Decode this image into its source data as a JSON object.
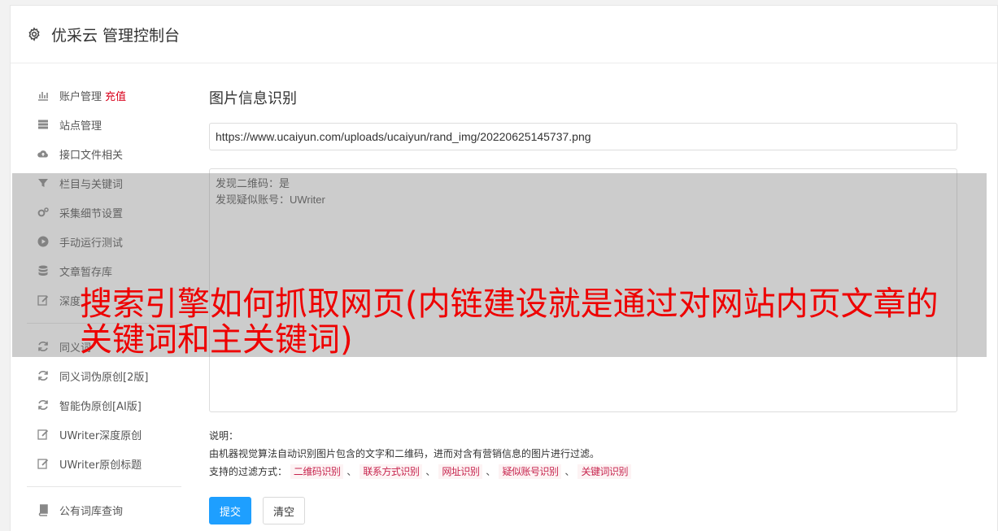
{
  "header": {
    "title": "优采云 管理控制台",
    "icon": "gear-icon"
  },
  "sidebar": {
    "items": [
      {
        "label": "账户管理",
        "extra": "充值",
        "icon": "bar-chart-icon"
      },
      {
        "label": "站点管理",
        "icon": "server-icon"
      },
      {
        "label": "接口文件相关",
        "icon": "cloud-upload-icon"
      },
      {
        "label": "栏目与关键词",
        "icon": "filter-icon"
      },
      {
        "label": "采集细节设置",
        "icon": "gears-icon"
      },
      {
        "label": "手动运行测试",
        "icon": "play-circle-icon"
      },
      {
        "label": "文章暂存库",
        "icon": "database-icon"
      },
      {
        "label": "深度",
        "icon": "edit-icon"
      }
    ],
    "items2": [
      {
        "label": "同义词",
        "icon": "refresh-icon"
      },
      {
        "label": "同义词伪原创[2版]",
        "icon": "refresh-icon"
      },
      {
        "label": "智能伪原创[AI版]",
        "icon": "refresh-icon"
      },
      {
        "label": "UWriter深度原创",
        "icon": "edit-icon"
      },
      {
        "label": "UWriter原创标题",
        "icon": "edit-icon"
      }
    ],
    "items3": [
      {
        "label": "公有词库查询",
        "icon": "book-icon"
      }
    ]
  },
  "main": {
    "title": "图片信息识别",
    "url_value": "https://www.ucaiyun.com/uploads/ucaiyun/rand_img/20220625145737.png",
    "result_value": "发现二维码：是\n发现疑似账号：UWriter",
    "notes_label": "说明：",
    "notes_desc": "由机器视觉算法自动识别图片包含的文字和二维码，进而对含有营销信息的图片进行过滤。",
    "filters_label": "支持的过滤方式：",
    "filters": [
      "二维码识别",
      "联系方式识别",
      "网址识别",
      "疑似账号识别",
      "关键词识别"
    ],
    "submit_label": "提交",
    "clear_label": "清空"
  },
  "overlay": {
    "text": "搜索引擎如何抓取网页(内链建设就是通过对网站内页文章的关键词和主关键词)",
    "color": "#ee0000"
  }
}
